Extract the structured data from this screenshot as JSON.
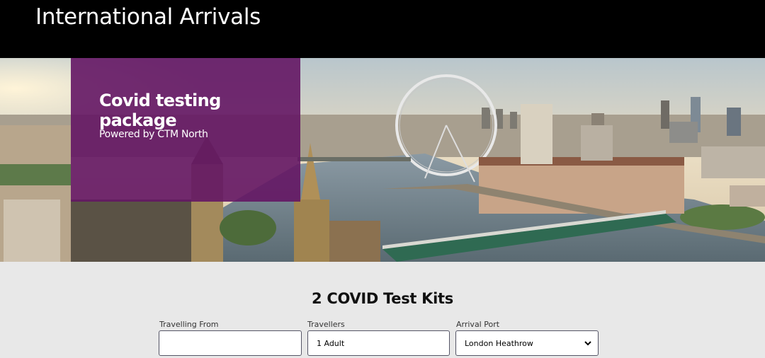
{
  "header": {
    "title": "International Arrivals"
  },
  "promo": {
    "title": "Covid testing package",
    "subtitle": "Powered by CTM North"
  },
  "main": {
    "heading": "2 COVID Test Kits",
    "fields": {
      "from_label": "Travelling From",
      "from_value": "",
      "travellers_label": "Travellers",
      "travellers_value": "1 Adult",
      "port_label": "Arrival Port",
      "port_value": "London Heathrow"
    }
  },
  "colors": {
    "header_bg": "#000000",
    "promo_bg": "#641664",
    "page_bg": "#e8e8e8"
  },
  "icons": {
    "select_chevron": "chevron-down-icon",
    "hero_image": "london-skyline-image"
  }
}
